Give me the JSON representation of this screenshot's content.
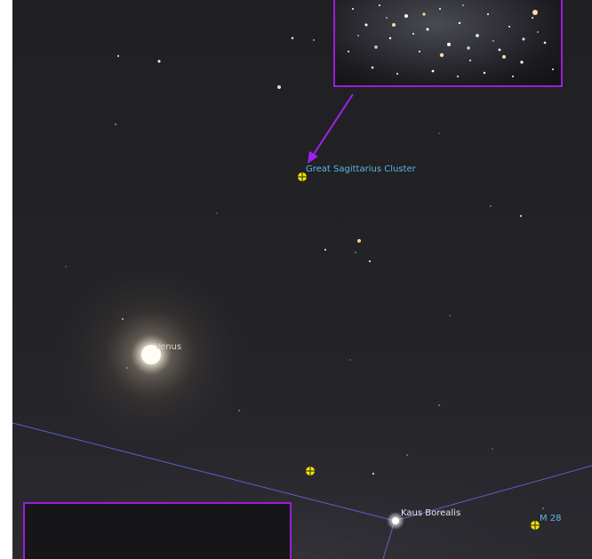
{
  "labels": {
    "great_sagittarius_cluster": "Great Sagittarius Cluster",
    "venus": "Venus",
    "kaus_borealis": "Kaus Borealis",
    "m28": "M 28"
  },
  "colors": {
    "dso_label": "#59b8e6",
    "dso_marker": "#f2e400",
    "constellation_line": "#6a6ff0",
    "inset_border": "#9a1fd6",
    "pointer_arrow": "#a020f0"
  },
  "icons": {
    "dso_marker": "circle-crosshair-icon",
    "pointer": "arrow-icon"
  }
}
